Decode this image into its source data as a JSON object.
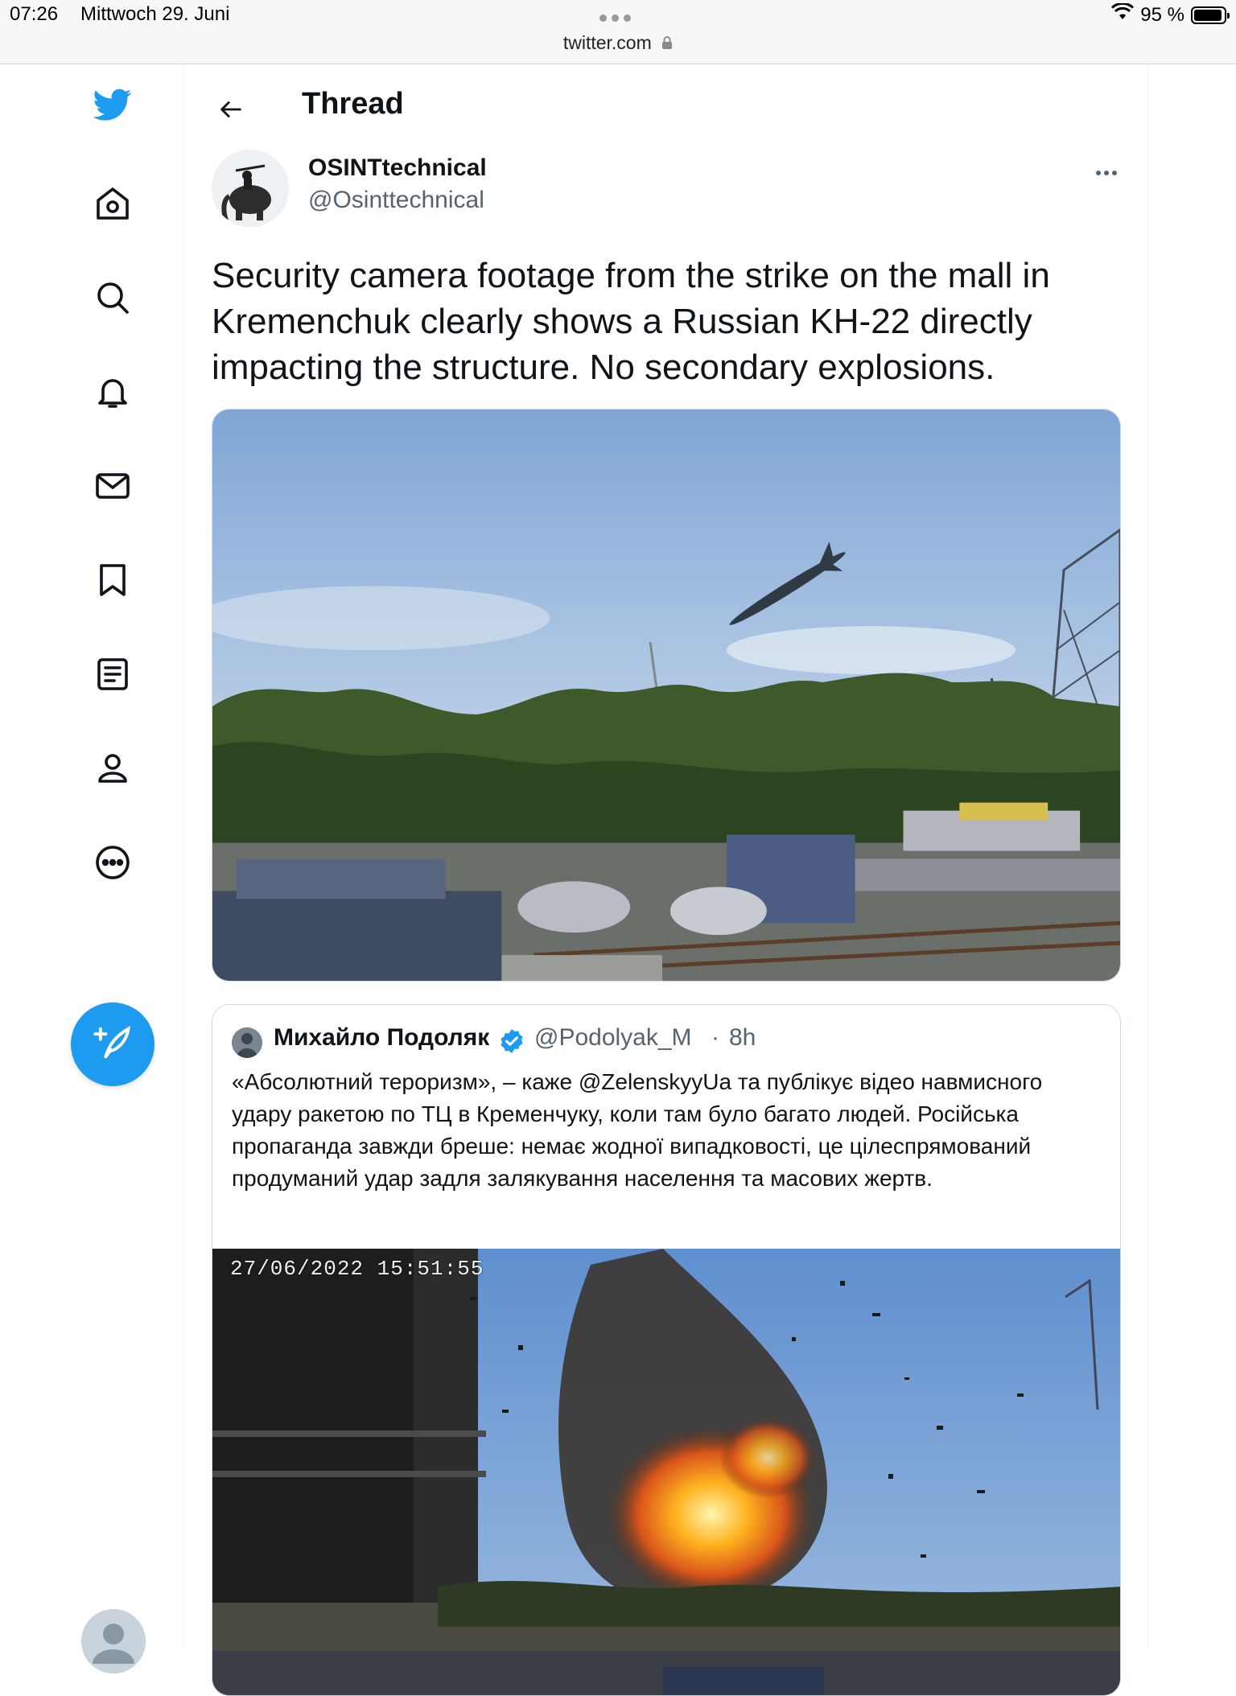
{
  "status_bar": {
    "time": "07:26",
    "date": "Mittwoch 29. Juni",
    "url": "twitter.com",
    "battery": "95 %",
    "battery_level": 0.95
  },
  "sidebar": {
    "items": [
      {
        "icon": "twitter-logo-icon"
      },
      {
        "icon": "home-icon"
      },
      {
        "icon": "search-icon"
      },
      {
        "icon": "notifications-bell-icon"
      },
      {
        "icon": "messages-envelope-icon"
      },
      {
        "icon": "bookmark-icon"
      },
      {
        "icon": "lists-icon"
      },
      {
        "icon": "profile-icon"
      },
      {
        "icon": "more-circle-icon"
      }
    ],
    "compose_icon": "compose-feather-icon"
  },
  "header": {
    "title": "Thread"
  },
  "tweet": {
    "author_name": "OSINTtechnical",
    "author_handle": "@Osinttechnical",
    "text": "Security camera footage from the strike on the mall in Kremenchuk clearly shows a Russian KH-22 directly impacting the structure. No secondary explosions."
  },
  "quote": {
    "author_name": "Михайло Подоляк",
    "author_handle": "@Podolyak_M",
    "separator": "·",
    "time": "8h",
    "text": "«Абсолютний тероризм», – каже @ZelenskyyUa та публікує відео навмисного удару ракетою по ТЦ в Кременчуку, коли там було багато людей. Російська пропаганда завжди бреше: немає жодної випадковості, це цілеспрямований продуманий удар задля залякування населення та масових жертв.",
    "video_timestamp": "27/06/2022 15:51:55"
  },
  "colors": {
    "brand": "#1d9bf0",
    "text_primary": "#0f1419",
    "text_secondary": "#536471",
    "border": "#cfd9de"
  }
}
